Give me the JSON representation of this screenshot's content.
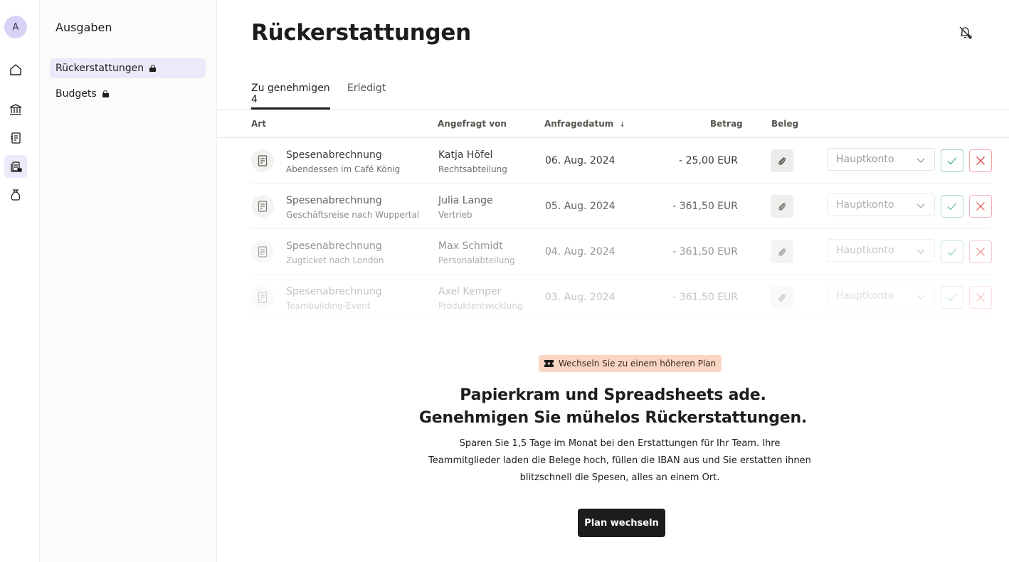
{
  "user": {
    "avatar_initial": "A"
  },
  "sidebar": {
    "title": "Ausgaben",
    "items": [
      {
        "label": "Rückerstattungen",
        "locked": true,
        "active": true
      },
      {
        "label": "Budgets",
        "locked": true,
        "active": false
      }
    ]
  },
  "page": {
    "title": "Rückerstattungen"
  },
  "tabs": [
    {
      "label": "Zu genehmigen 4",
      "active": true
    },
    {
      "label": "Erledigt",
      "active": false
    }
  ],
  "table": {
    "columns": [
      "Art",
      "Angefragt von",
      "Anfragedatum",
      "Betrag",
      "Beleg"
    ],
    "sort_indicator": "↓",
    "rows": [
      {
        "type": "Spesenabrechnung",
        "description": "Abendessen im Café König",
        "requester": "Katja Höfel",
        "department": "Rechtsabteilung",
        "date": "06. Aug. 2024",
        "amount": "- 25,00 EUR",
        "account": "Hauptkonto",
        "opacity": 1.0
      },
      {
        "type": "Spesenabrechnung",
        "description": "Geschäftsreise nach Wuppertal",
        "requester": "Julia Lange",
        "department": "Vertrieb",
        "date": "05. Aug. 2024",
        "amount": "- 361,50 EUR",
        "account": "Hauptkonto",
        "opacity": 0.8
      },
      {
        "type": "Spesenabrechnung",
        "description": "Zugticket nach London",
        "requester": "Max Schmidt",
        "department": "Personalabteilung",
        "date": "04. Aug. 2024",
        "amount": "- 361,50 EUR",
        "account": "Hauptkonto",
        "opacity": 0.55
      },
      {
        "type": "Spesenabrechnung",
        "description": "Teambuilding-Event",
        "requester": "Axel Kemper",
        "department": "Produktentwicklung",
        "date": "03. Aug. 2024",
        "amount": "- 361,50 EUR",
        "account": "Hauptkonto",
        "opacity": 0.3
      }
    ]
  },
  "upsell": {
    "badge": "Wechseln Sie zu einem höheren Plan",
    "headline_1": "Papierkram und Spreadsheets ade.",
    "headline_2": "Genehmigen Sie mühelos Rückerstattungen.",
    "body": "Sparen Sie 1,5 Tage im Monat bei den Erstattungen für Ihr Team. Ihre Teammitglieder laden die Belege hoch, füllen die IBAN aus und Sie erstatten ihnen blitzschnell die Spesen, alles an einem Ort.",
    "cta": "Plan wechseln"
  },
  "icons": [
    "home-icon",
    "bank-icon",
    "invoice-icon",
    "reimbursement-icon",
    "money-bag-icon",
    "bell-plus-icon",
    "document-icon",
    "paperclip-icon",
    "check-icon",
    "close-icon",
    "chevron-down-icon",
    "ticket-icon"
  ],
  "colors": {
    "accent_bg": "#ece9fb",
    "approve": "#4fb886",
    "reject": "#e5484d",
    "badge_bg": "#f9d6c3",
    "cta_bg": "#1d1d1b"
  }
}
